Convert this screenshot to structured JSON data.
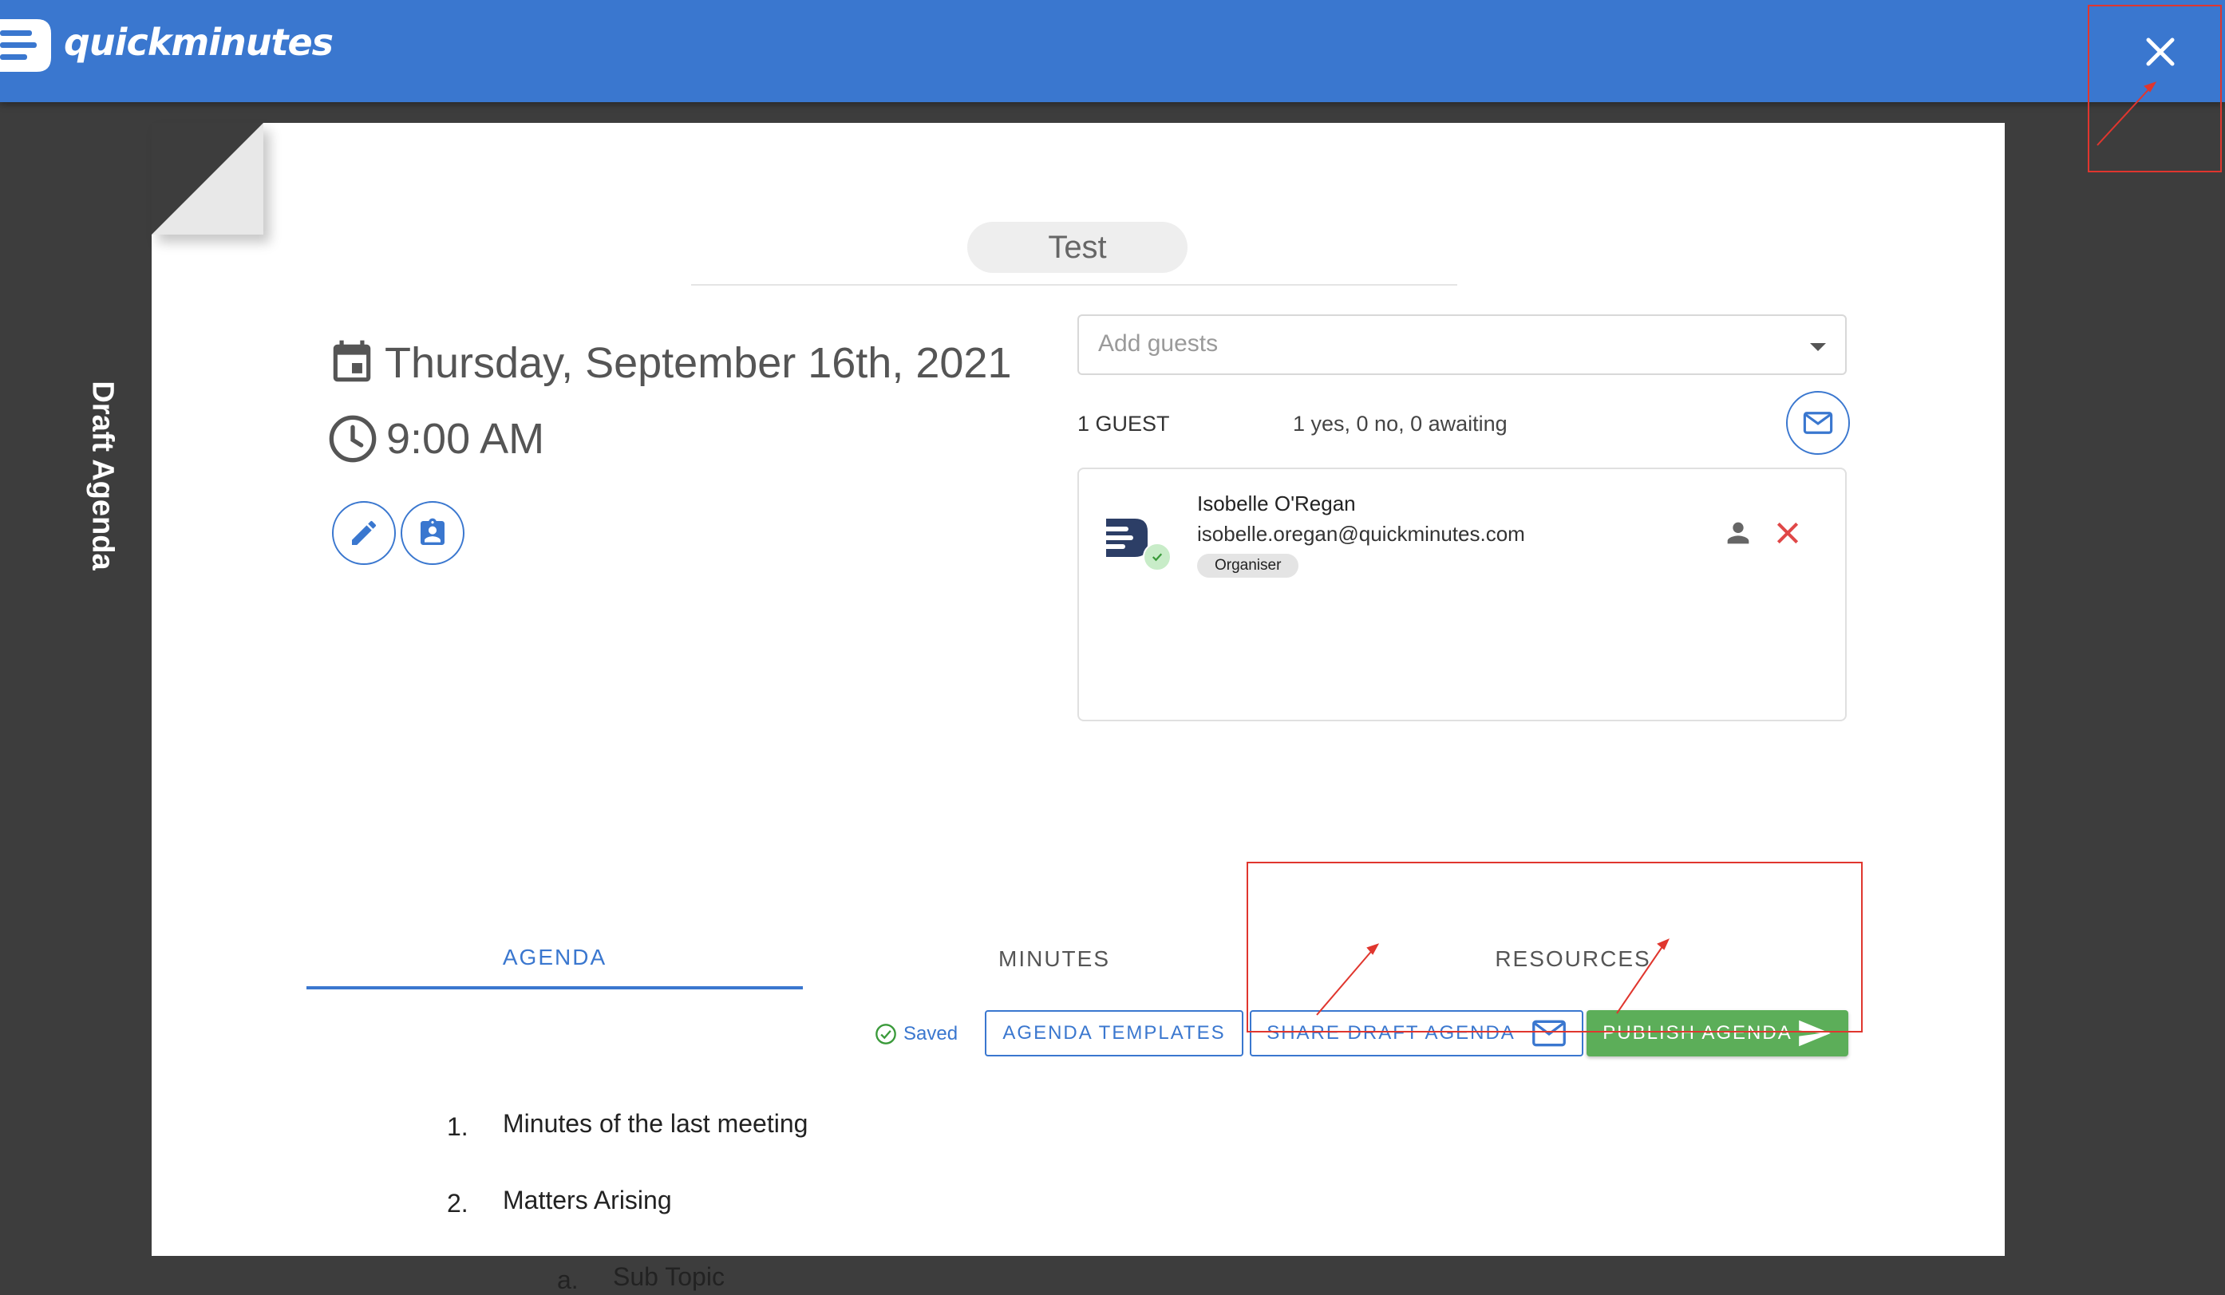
{
  "header": {
    "app_name": "quickminutes",
    "close_icon": "close-icon",
    "color": "#3a77cf"
  },
  "sidebar": {
    "label": "Draft Agenda"
  },
  "meeting": {
    "title": "Test",
    "date": "Thursday, September 16th, 2021",
    "time": "9:00 AM",
    "icons": {
      "date": "calendar-icon",
      "time": "clock-icon",
      "edit": "pencil-icon",
      "details": "contact-badge-icon"
    }
  },
  "guests": {
    "placeholder": "Add guests",
    "count_label": "1 GUEST",
    "status": "1 yes, 0 no, 0 awaiting",
    "email_icon": "mail-icon",
    "list": [
      {
        "name": "Isobelle O'Regan",
        "email": "isobelle.oregan@quickminutes.com",
        "role": "Organiser",
        "status_color": "#c8ecc8"
      }
    ]
  },
  "tabs": [
    {
      "label": "AGENDA",
      "active": true
    },
    {
      "label": "MINUTES",
      "active": false
    },
    {
      "label": "RESOURCES",
      "active": false
    }
  ],
  "toolbar": {
    "saved_label": "Saved",
    "templates_label": "AGENDA TEMPLATES",
    "share_label": "SHARE DRAFT AGENDA",
    "publish_label": "PUBLISH AGENDA",
    "publish_color": "#5cae59"
  },
  "agenda": [
    {
      "marker": "1.",
      "text": "Minutes of the last meeting"
    },
    {
      "marker": "2.",
      "text": "Matters Arising"
    },
    {
      "marker": "a.",
      "text": "Sub Topic"
    }
  ],
  "annotation_color": "#e0362e"
}
